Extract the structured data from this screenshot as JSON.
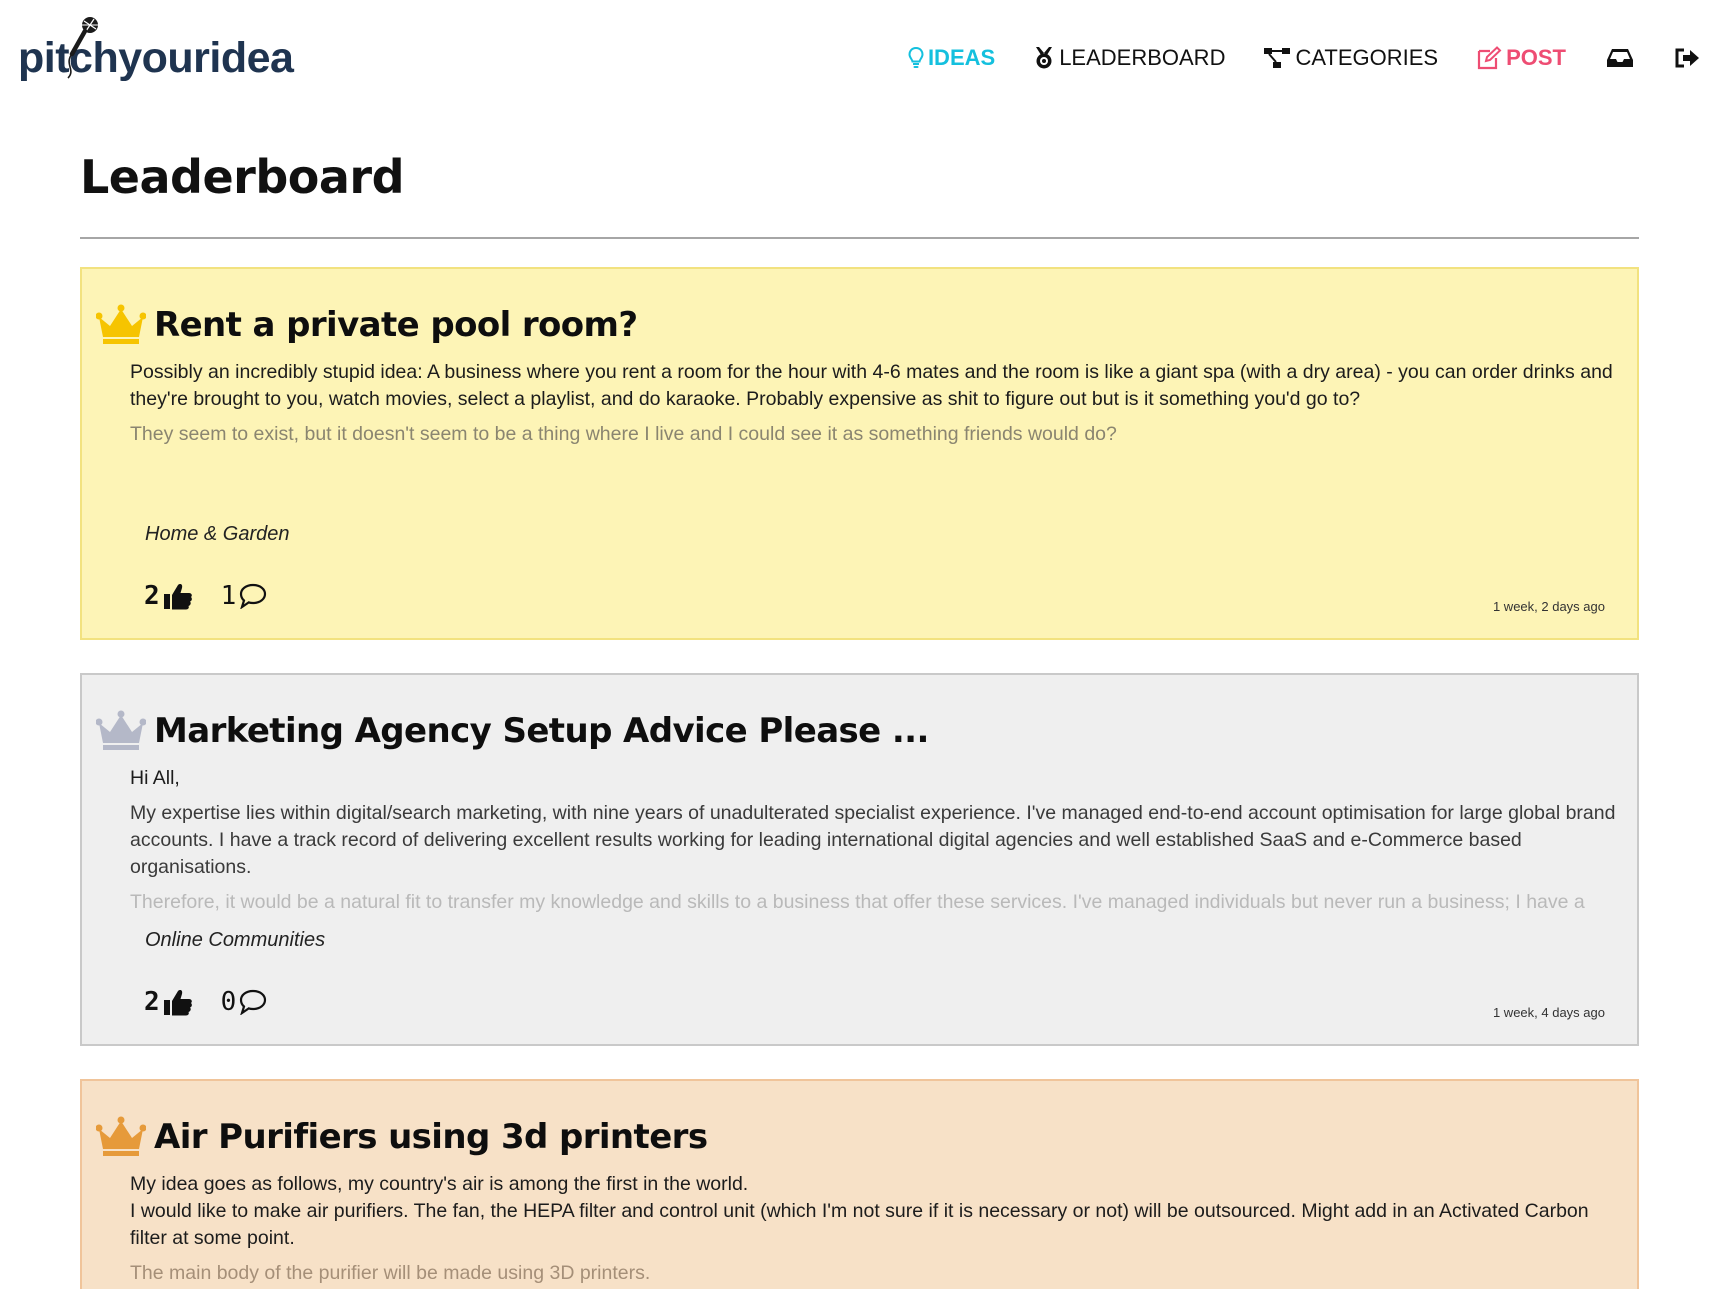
{
  "brand": {
    "logo_text": "pitchyouridea"
  },
  "nav": {
    "ideas": "IDEAS",
    "leaderboard": "LEADERBOARD",
    "categories": "CATEGORIES",
    "post": "POST"
  },
  "page": {
    "title": "Leaderboard"
  },
  "colors": {
    "accent": "#14c0de",
    "post": "#ee4d73",
    "gold_bg": "#fdf4b6",
    "silver_bg": "#efefef",
    "bronze_bg": "#f7e1c7",
    "gold_crown": "#f6c400",
    "silver_crown": "#b4b8c8",
    "bronze_crown": "#e69a3a"
  },
  "ideas": [
    {
      "rank": "gold",
      "crown_icon": "crown-icon",
      "title": "Rent a private pool room?",
      "body": [
        "Possibly an incredibly stupid idea: A business where you rent a room for the hour with 4-6 mates and the room is like a giant spa (with a dry area) - you can order drinks and they're brought to you, watch movies, select a playlist, and do karaoke. Probably expensive as shit to figure out but is it something you'd go to?",
        "They seem to exist, but it doesn't seem to be a thing where I live and I could see it as something friends would do?"
      ],
      "category": "Home & Garden",
      "likes": "2",
      "comments": "1",
      "posted": "1 week, 2 days ago"
    },
    {
      "rank": "silver",
      "crown_icon": "crown-icon",
      "title": "Marketing Agency Setup Advice Please ...",
      "body": [
        "Hi All,",
        "My expertise lies within digital/search marketing, with nine years of unadulterated specialist experience. I've managed end-to-end account optimisation for large global brand accounts. I have a track record of delivering excellent results working for leading international digital agencies and well established SaaS and e-Commerce based organisations.",
        "Therefore, it would be a natural fit to transfer my knowledge and skills to a business that offer these services. I've managed individuals but never run a business; I have a deep-seated desire and passion for becoming my own boss while living on a modest but comfortable income."
      ],
      "category": "Online Communities",
      "likes": "2",
      "comments": "0",
      "posted": "1 week, 4 days ago"
    },
    {
      "rank": "bronze",
      "crown_icon": "crown-icon",
      "title": "Air Purifiers using 3d printers",
      "body": [
        "My idea goes as follows, my country's air is among the first in the world.",
        "I would like to make air purifiers. The fan, the HEPA filter and control unit (which I'm not sure if it is necessary or not) will be outsourced. Might add in an Activated Carbon filter at some point.",
        "The main body of the purifier will be made using 3D printers."
      ]
    }
  ]
}
